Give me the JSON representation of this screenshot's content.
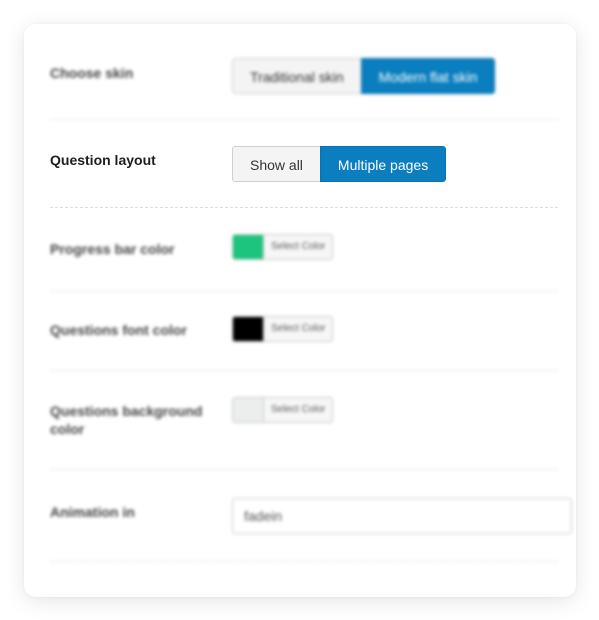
{
  "settings": {
    "skin": {
      "label": "Choose skin",
      "options": [
        "Traditional skin",
        "Modern flat skin"
      ],
      "selected": "Modern flat skin"
    },
    "layout": {
      "label": "Question layout",
      "options": [
        "Show all",
        "Multiple pages"
      ],
      "selected": "Multiple pages"
    },
    "progress_color": {
      "label": "Progress bar color",
      "button_text": "Select Color",
      "color": "#1dc47e"
    },
    "font_color": {
      "label": "Questions font color",
      "button_text": "Select Color",
      "color": "#000000"
    },
    "bg_color": {
      "label": "Questions background color",
      "button_text": "Select Color",
      "color": "#eceeee"
    },
    "animation": {
      "label": "Animation in",
      "value": "fadein"
    }
  },
  "colors": {
    "accent": "#0a7ebf"
  }
}
